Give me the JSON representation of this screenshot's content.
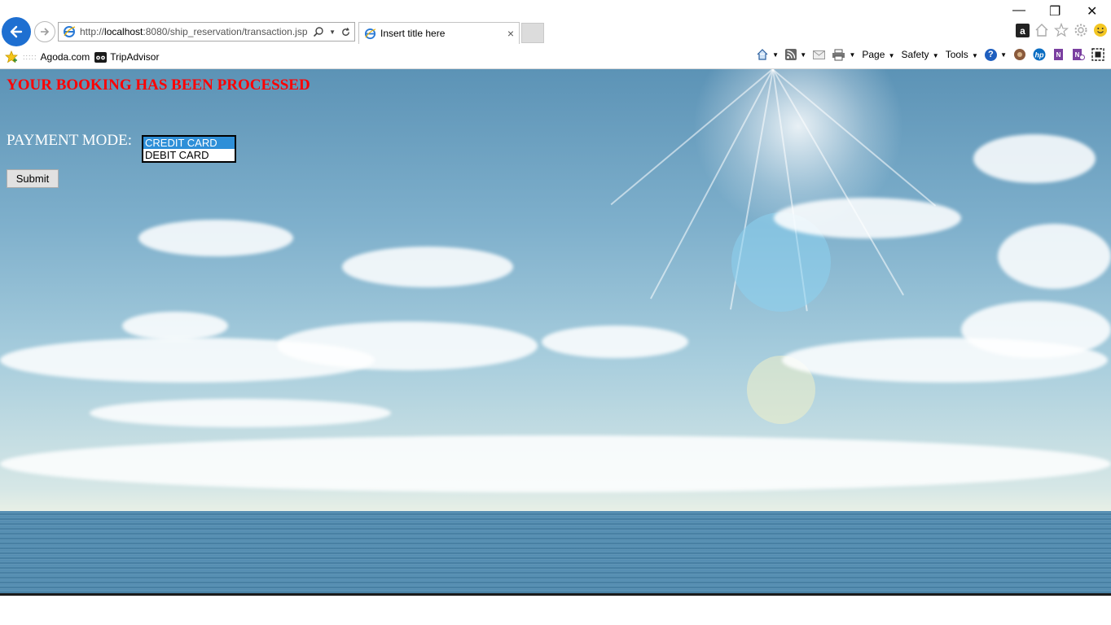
{
  "browser": {
    "address": {
      "prefix": "http://",
      "host": "localhost",
      "rest": ":8080/ship_reservation/transaction.jsp"
    },
    "tab_title": "Insert title here",
    "tab_close": "×",
    "window_controls": {
      "minimize": "—",
      "restore": "❐",
      "close": "✕"
    },
    "favorites": [
      {
        "label": "Agoda.com",
        "icon": "agoda-icon"
      },
      {
        "label": "TripAdvisor",
        "icon": "tripadvisor-icon"
      }
    ],
    "command_bar": {
      "page": "Page",
      "safety": "Safety",
      "tools": "Tools",
      "help": "?"
    },
    "icons": [
      "back-icon",
      "forward-icon",
      "search-icon",
      "refresh-icon",
      "home-icon",
      "star-icon",
      "gear-icon",
      "smiley-icon",
      "amazon-icon",
      "feed-icon",
      "mail-icon",
      "print-icon"
    ]
  },
  "page": {
    "heading": "YOUR BOOKING HAS BEEN PROCESSED",
    "payment_label": "PAYMENT MODE:",
    "payment_options": [
      "CREDIT CARD",
      "DEBIT CARD"
    ],
    "payment_selected": "CREDIT CARD",
    "submit_label": "Submit"
  },
  "colors": {
    "heading": "#ff0000",
    "label": "#ffffff",
    "selected_option": "#2e8fd8",
    "back_button": "#1e6fd1"
  }
}
